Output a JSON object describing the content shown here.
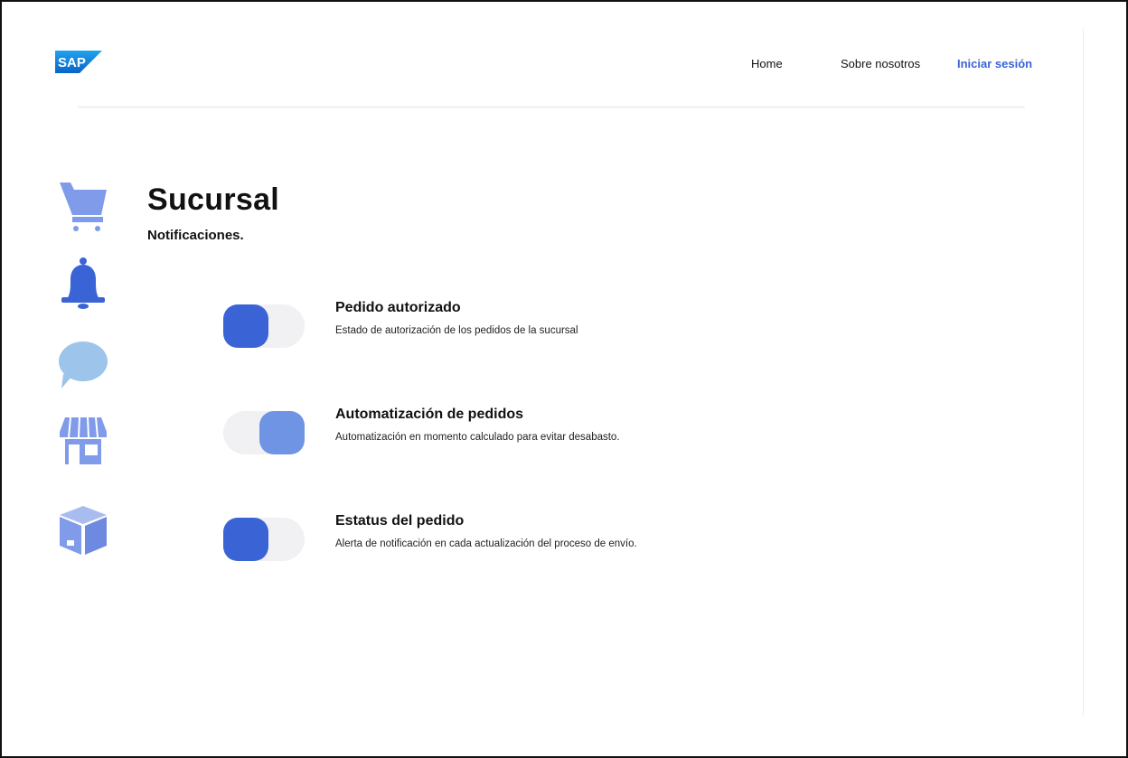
{
  "header": {
    "logo_text": "SAP",
    "nav": {
      "home": "Home",
      "about": "Sobre nosotros",
      "login": "Iniciar sesión"
    }
  },
  "page": {
    "title": "Sucursal",
    "subtitle": "Notificaciones."
  },
  "sidebar": {
    "icons": [
      "cart-icon",
      "bell-icon",
      "chat-icon",
      "store-icon",
      "box-icon"
    ]
  },
  "settings": [
    {
      "title": "Pedido autorizado",
      "description": "Estado de autorización de los pedidos de la sucursal",
      "enabled": false
    },
    {
      "title": "Automatización de pedidos",
      "description": "Automatización en momento calculado para evitar desabasto.",
      "enabled": true
    },
    {
      "title": "Estatus del pedido",
      "description": "Alerta de notificación en cada actualización del proceso de envío.",
      "enabled": false
    }
  ],
  "colors": {
    "accent": "#3a63d6",
    "accent_light": "#6e94e3",
    "icon_blue": "#7f9bea",
    "chat_blue": "#9dc4ea",
    "toggle_track": "#f1f1f3"
  }
}
